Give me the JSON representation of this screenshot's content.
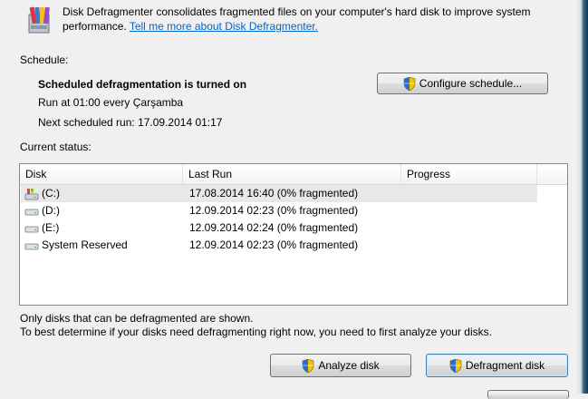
{
  "header": {
    "intro_text": "Disk Defragmenter consolidates fragmented files on your computer's hard disk to improve system performance.",
    "learn_more_link": "Tell me more about Disk Defragmenter."
  },
  "schedule": {
    "section_label": "Schedule:",
    "title": "Scheduled defragmentation is turned on",
    "run_text": "Run at 01:00 every Çarşamba",
    "next_run_text": "Next scheduled run: 17.09.2014 01:17",
    "configure_button": "Configure schedule..."
  },
  "status": {
    "section_label": "Current status:",
    "columns": [
      "Disk",
      "Last Run",
      "Progress"
    ],
    "rows": [
      {
        "disk": "(C:)",
        "last_run": "17.08.2014 16:40 (0% fragmented)",
        "progress": "",
        "icon": "system-drive-icon"
      },
      {
        "disk": "(D:)",
        "last_run": "12.09.2014 02:23 (0% fragmented)",
        "progress": "",
        "icon": "drive-icon"
      },
      {
        "disk": "(E:)",
        "last_run": "12.09.2014 02:24 (0% fragmented)",
        "progress": "",
        "icon": "drive-icon"
      },
      {
        "disk": "System Reserved",
        "last_run": "12.09.2014 02:23 (0% fragmented)",
        "progress": "",
        "icon": "drive-icon"
      }
    ]
  },
  "notes": {
    "line1": "Only disks that can be defragmented are shown.",
    "line2": "To best determine if your disks need defragmenting right now, you need to first analyze your disks."
  },
  "actions": {
    "analyze_button": "Analyze disk",
    "defragment_button": "Defragment disk"
  }
}
